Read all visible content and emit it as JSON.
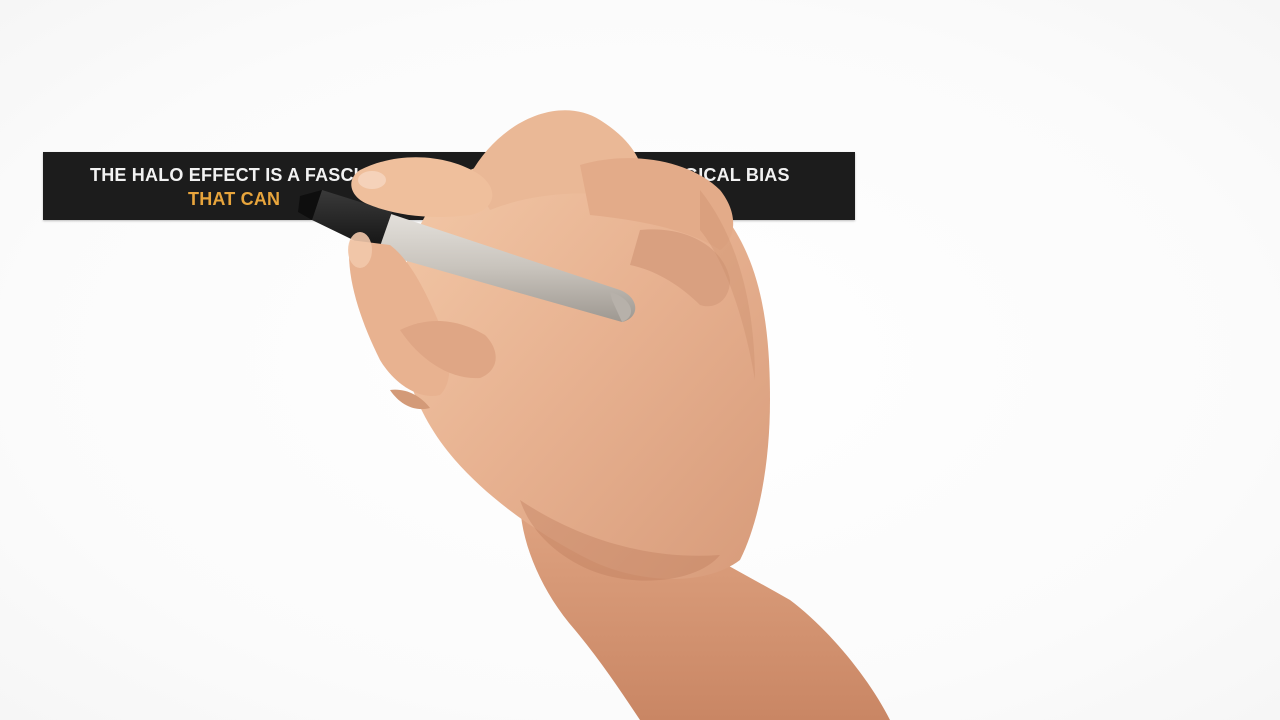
{
  "caption": {
    "line1_visible_start": "THE HALO EFFECT IS A FASCI",
    "line1_visible_end": "CHOLOGICAL BIAS",
    "line2_visible": "THAT CAN",
    "line1_color": "#f2f2f2",
    "line2_color": "#e8a53c",
    "bar_color": "#1c1c1c"
  },
  "scene": {
    "background": "#ffffff",
    "hand_icon": "hand-holding-marker-icon",
    "marker_color": "#c9c4bd"
  }
}
